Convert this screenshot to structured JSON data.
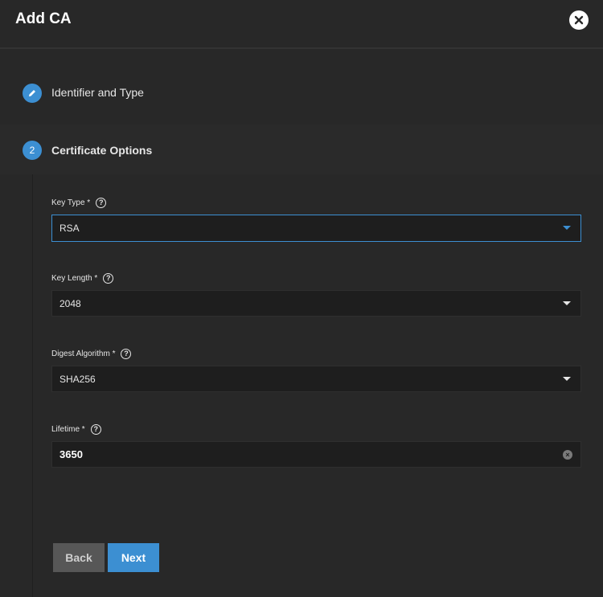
{
  "dialog": {
    "title": "Add CA",
    "close_icon": "close-icon"
  },
  "steps": [
    {
      "label": "Identifier and Type",
      "marker": "✎",
      "icon": "pencil-icon"
    },
    {
      "label": "Certificate Options",
      "marker": "2"
    }
  ],
  "form": {
    "key_type": {
      "label": "Key Type *",
      "value": "RSA"
    },
    "key_length": {
      "label": "Key Length *",
      "value": "2048"
    },
    "digest_algorithm": {
      "label": "Digest Algorithm *",
      "value": "SHA256"
    },
    "lifetime": {
      "label": "Lifetime *",
      "value": "3650"
    },
    "help_glyph": "?"
  },
  "buttons": {
    "back": "Back",
    "next": "Next"
  },
  "colors": {
    "accent": "#3c8fd2",
    "background": "#282828",
    "input_bg": "#1e1e1e"
  }
}
